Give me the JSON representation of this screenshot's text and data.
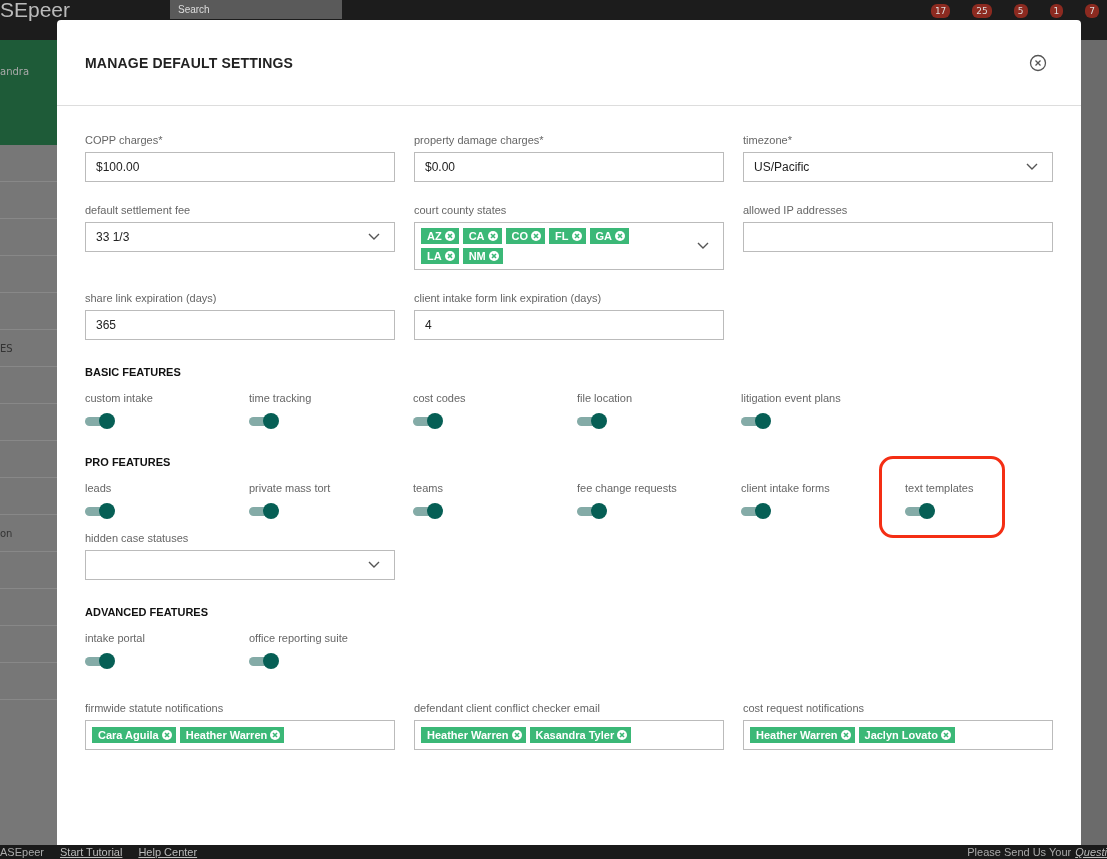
{
  "app_bar": {
    "logo": "SEpeer",
    "search": {
      "placeholder": "Search"
    },
    "badges": [
      "17",
      "25",
      "5",
      "1",
      "7"
    ]
  },
  "sidebar": {
    "user": "andra",
    "items": [
      "ES",
      "on"
    ]
  },
  "modal": {
    "title": "MANAGE DEFAULT SETTINGS",
    "fields": [
      {
        "kind": "text",
        "label": "COPP charges*",
        "value": "$100.00"
      },
      {
        "kind": "text",
        "label": "property damage charges*",
        "value": "$0.00"
      },
      {
        "kind": "select",
        "label": "timezone*",
        "value": "US/Pacific"
      },
      {
        "kind": "select",
        "label": "default settlement fee",
        "value": "33 1/3"
      },
      {
        "kind": "tags",
        "label": "court county states",
        "tags": [
          "AZ",
          "CA",
          "CO",
          "FL",
          "GA",
          "LA",
          "NM"
        ]
      },
      {
        "kind": "text",
        "label": "allowed IP addresses"
      },
      {
        "kind": "text",
        "label": "share link expiration (days)",
        "value": "365"
      },
      {
        "kind": "text",
        "label": "client intake form link expiration (days)",
        "value": "4"
      }
    ],
    "sections": [
      {
        "title": "BASIC FEATURES",
        "toggles": [
          {
            "label": "custom intake",
            "on": true,
            "highlighted": false
          },
          {
            "label": "time tracking",
            "on": true,
            "highlighted": false
          },
          {
            "label": "cost codes",
            "on": true,
            "highlighted": false
          },
          {
            "label": "file location",
            "on": true,
            "highlighted": false
          },
          {
            "label": "litigation event plans",
            "on": true,
            "highlighted": false
          }
        ]
      },
      {
        "title": "PRO FEATURES",
        "toggles": [
          {
            "label": "leads",
            "on": true,
            "highlighted": false
          },
          {
            "label": "private mass tort",
            "on": true,
            "highlighted": false
          },
          {
            "label": "teams",
            "on": true,
            "highlighted": false
          },
          {
            "label": "fee change requests",
            "on": true,
            "highlighted": false
          },
          {
            "label": "client intake forms",
            "on": true,
            "highlighted": false
          },
          {
            "label": "text templates",
            "on": true,
            "highlighted": true
          }
        ],
        "fields": [
          {
            "kind": "select",
            "label": "hidden case statuses"
          }
        ]
      },
      {
        "title": "ADVANCED FEATURES",
        "toggles": [
          {
            "label": "intake portal",
            "on": true,
            "highlighted": false
          },
          {
            "label": "office reporting suite",
            "on": true,
            "highlighted": false
          }
        ]
      }
    ],
    "notifications": [
      {
        "kind": "tags",
        "label": "firmwide statute notifications",
        "tags": [
          "Cara Aguila",
          "Heather Warren"
        ]
      },
      {
        "kind": "tags",
        "label": "defendant client conflict checker email",
        "tags": [
          "Heather Warren",
          "Kasandra Tyler"
        ]
      },
      {
        "kind": "tags",
        "label": "cost request notifications",
        "tags": [
          "Heather Warren",
          "Jaclyn Lovato"
        ]
      }
    ]
  },
  "footer": {
    "brand": "ASEpeer",
    "links": [
      "Start Tutorial",
      "Help Center"
    ],
    "message": "Please Send Us Your",
    "message_link": "Questi"
  }
}
